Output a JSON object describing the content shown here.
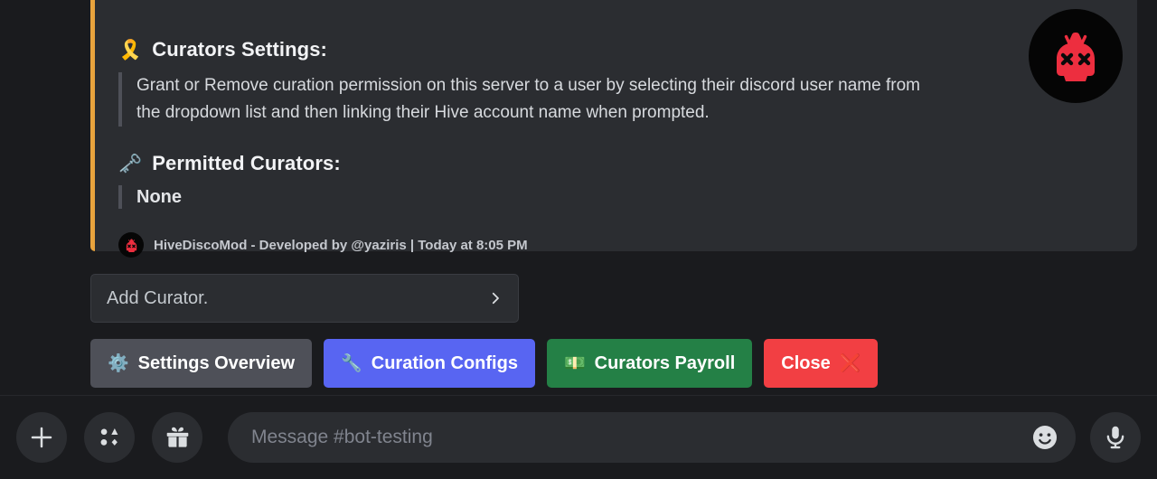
{
  "embed": {
    "accent_color": "#E8A33D",
    "background_color": "#2b2d31",
    "thumbnail_icon": "bot-avatar-icon",
    "fields": [
      {
        "emoji": "🎗️",
        "emoji_name": "ribbon-icon",
        "title": "Curators Settings:",
        "quote": "Grant or Remove curation permission on this server to a user by selecting their discord user name from the dropdown list and then linking their Hive account name when prompted."
      },
      {
        "emoji": "🗝️",
        "emoji_name": "key-icon",
        "title": "Permitted Curators:",
        "quote": "None"
      }
    ],
    "footer": {
      "avatar_icon": "bot-avatar-icon",
      "text": "HiveDiscoMod - Developed by @yaziris | Today at 8:05 PM"
    }
  },
  "select_menu": {
    "placeholder": "Add Curator.",
    "chevron_icon": "chevron-right-icon"
  },
  "buttons": [
    {
      "label": "Settings Overview",
      "emoji": "⚙️",
      "emoji_name": "gear-icon",
      "style": "secondary",
      "color": "#4e5058"
    },
    {
      "label": "Curation Configs",
      "emoji": "🔧",
      "emoji_name": "wrench-icon",
      "style": "primary",
      "color": "#5865f2"
    },
    {
      "label": "Curators Payroll",
      "emoji": "💵",
      "emoji_name": "banknote-icon",
      "style": "success",
      "color": "#248046"
    },
    {
      "label": "Close",
      "emoji": "❌",
      "emoji_name": "cross-mark-icon",
      "style": "danger",
      "color": "#f23f43"
    }
  ],
  "composer": {
    "attach_icon": "plus-icon",
    "sticker_icon": "sticker-icon",
    "gift_icon": "gift-icon",
    "placeholder": "Message #bot-testing",
    "emoji_icon": "emoji-smiley-icon",
    "mic_icon": "microphone-icon"
  }
}
